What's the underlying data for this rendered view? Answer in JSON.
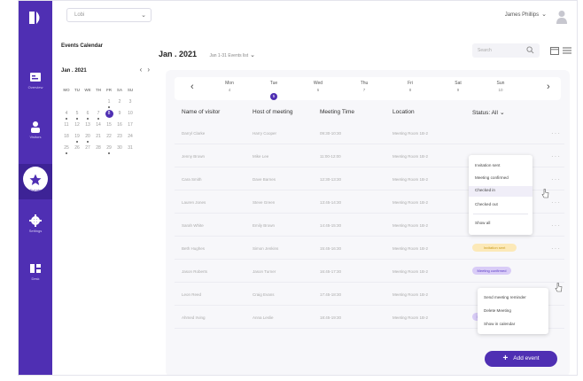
{
  "topbar": {
    "workspace": "Lobi",
    "user_name": "James Phillips"
  },
  "nav": {
    "items": [
      {
        "label": "Overview"
      },
      {
        "label": "Visitors"
      },
      {
        "label": "Events"
      },
      {
        "label": "Settings"
      },
      {
        "label": "Desk"
      }
    ]
  },
  "calendar": {
    "title": "Events Calendar",
    "month": "Jan . 2021",
    "weekdays": [
      "MO",
      "TU",
      "WE",
      "TH",
      "FR",
      "SA",
      "SU"
    ],
    "weeks": [
      [
        "",
        "",
        "",
        "",
        "1",
        "2",
        "3"
      ],
      [
        "4",
        "5",
        "6",
        "7",
        "8",
        "9",
        "10"
      ],
      [
        "11",
        "12",
        "13",
        "14",
        "15",
        "16",
        "17"
      ],
      [
        "18",
        "19",
        "20",
        "21",
        "22",
        "23",
        "24"
      ],
      [
        "25",
        "26",
        "27",
        "28",
        "29",
        "30",
        "31"
      ]
    ]
  },
  "main": {
    "title": "Jan . 2021",
    "range": "Jan 1-31 Events list",
    "search_placeholder": "Search"
  },
  "week": {
    "days": [
      {
        "name": "Mon",
        "date": "4"
      },
      {
        "name": "Tue",
        "date": "5"
      },
      {
        "name": "Wed",
        "date": "6"
      },
      {
        "name": "Thu",
        "date": "7"
      },
      {
        "name": "Fri",
        "date": "8"
      },
      {
        "name": "Sat",
        "date": "9"
      },
      {
        "name": "Sun",
        "date": "10"
      }
    ]
  },
  "table": {
    "headers": {
      "visitor": "Name of visitor",
      "host": "Host of meeting",
      "time": "Meeting Time",
      "location": "Location",
      "status": "Status: All"
    },
    "rows": [
      {
        "visitor": "Darryl Clarke",
        "host": "Harry Cooper",
        "time": "09:30-10:30",
        "location": "Meeting Room 1B-2",
        "status": ""
      },
      {
        "visitor": "Jenny Brown",
        "host": "Mike Lee",
        "time": "11:00-12:00",
        "location": "Meeting Room 1B-2",
        "status": ""
      },
      {
        "visitor": "Cara Smith",
        "host": "Dave Barnes",
        "time": "12:30-13:30",
        "location": "Meeting Room 1B-2",
        "status": ""
      },
      {
        "visitor": "Lauren Jones",
        "host": "Steve Green",
        "time": "13:45-14:30",
        "location": "Meeting Room 1B-2",
        "status": "Checked in"
      },
      {
        "visitor": "Sarah White",
        "host": "Emily Brown",
        "time": "14:45-15:30",
        "location": "Meeting Room 1B-2",
        "status": "Checked out"
      },
      {
        "visitor": "Beth Hughes",
        "host": "Simon Jenkins",
        "time": "15:45-16:30",
        "location": "Meeting Room 1B-2",
        "status": "Invitation sent"
      },
      {
        "visitor": "Jason Roberts",
        "host": "Jason Turner",
        "time": "16:45-17:30",
        "location": "Meeting Room 1B-2",
        "status": "Meeting confirmed"
      },
      {
        "visitor": "Leon Reed",
        "host": "Craig Evans",
        "time": "17:45-18:30",
        "location": "Meeting Room 1B-2",
        "status": ""
      },
      {
        "visitor": "Ahmed Irving",
        "host": "Anna Leslie",
        "time": "18:45-19:30",
        "location": "Meeting Room 1B-2",
        "status": "Meeting confirmed"
      }
    ]
  },
  "status_menu": {
    "options": [
      "Invitation sent",
      "Meeting confirmed",
      "Checked in",
      "Checked out"
    ],
    "show_all": "Show all"
  },
  "row_menu": {
    "options": [
      "Send meeting reminder",
      "Delete Meeting",
      "Show in calendar"
    ]
  },
  "add_button": "Add event",
  "colors": {
    "accent": "#4f2fb3",
    "checked_in": "#3a9b4a",
    "checked_out": "#4a6fcf",
    "pending": "#c99a1a"
  }
}
